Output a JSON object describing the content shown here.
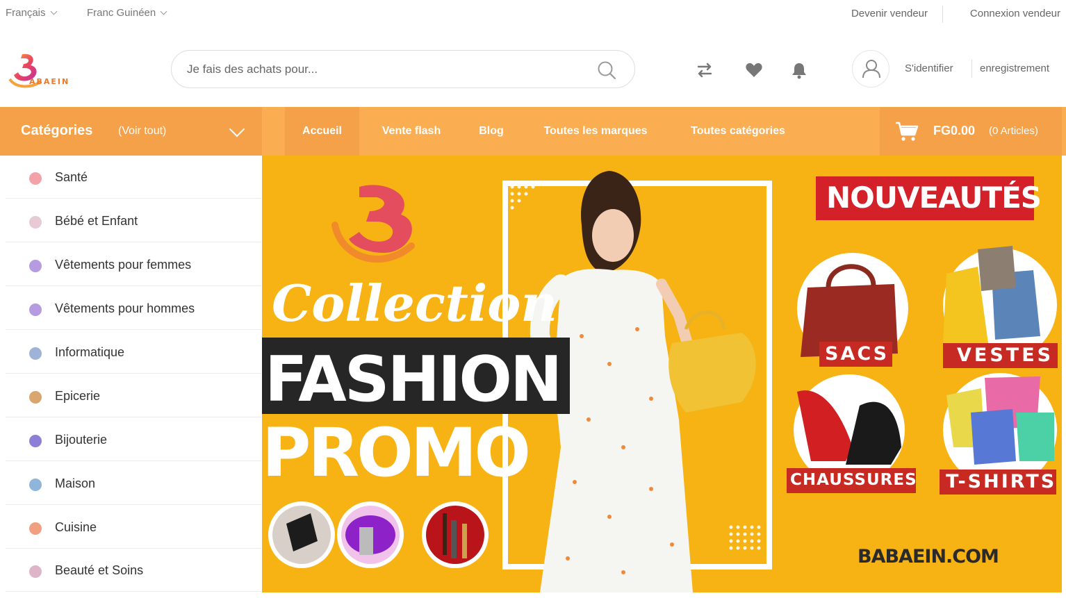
{
  "topbar": {
    "language": "Français",
    "currency": "Franc Guinéen",
    "become_seller": "Devenir vendeur",
    "seller_login": "Connexion vendeur"
  },
  "header": {
    "logo_text": "ABAEIN",
    "search_placeholder": "Je fais des achats pour...",
    "sign_in": "S'identifier",
    "register": "enregistrement"
  },
  "nav": {
    "categories_label": "Catégories",
    "see_all": "(Voir tout)",
    "items": [
      "Accueil",
      "Vente flash",
      "Blog",
      "Toutes les marques",
      "Toutes catégories"
    ],
    "cart_amount": "FG0.00",
    "cart_count": "(0 Articles)"
  },
  "categories": [
    {
      "label": "Santé",
      "color": "#f2a2a8"
    },
    {
      "label": "Bébé et Enfant",
      "color": "#e8c9d6"
    },
    {
      "label": "Vêtements pour femmes",
      "color": "#b59be0"
    },
    {
      "label": "Vêtements pour hommes",
      "color": "#b59be0"
    },
    {
      "label": "Informatique",
      "color": "#9fb3d8"
    },
    {
      "label": "Epicerie",
      "color": "#d8a66e"
    },
    {
      "label": "Bijouterie",
      "color": "#8e7fd6"
    },
    {
      "label": "Maison",
      "color": "#8fb6d8"
    },
    {
      "label": "Cuisine",
      "color": "#f0a080"
    },
    {
      "label": "Beauté et Soins",
      "color": "#e0b4c8"
    }
  ],
  "banner": {
    "script_text": "Collection",
    "fashion": "FASHION",
    "promo": "PROMO",
    "new_label": "NOUVEAUTÉS",
    "tiles": [
      "SACS",
      "VESTES",
      "CHAUSSURES",
      "T-SHIRTS"
    ],
    "website": "BABAEIN.COM"
  },
  "colors": {
    "nav_bg": "#fbad52",
    "nav_active": "#f4a14a",
    "banner_bg": "#f7b214",
    "badge_red": "#d42028"
  }
}
